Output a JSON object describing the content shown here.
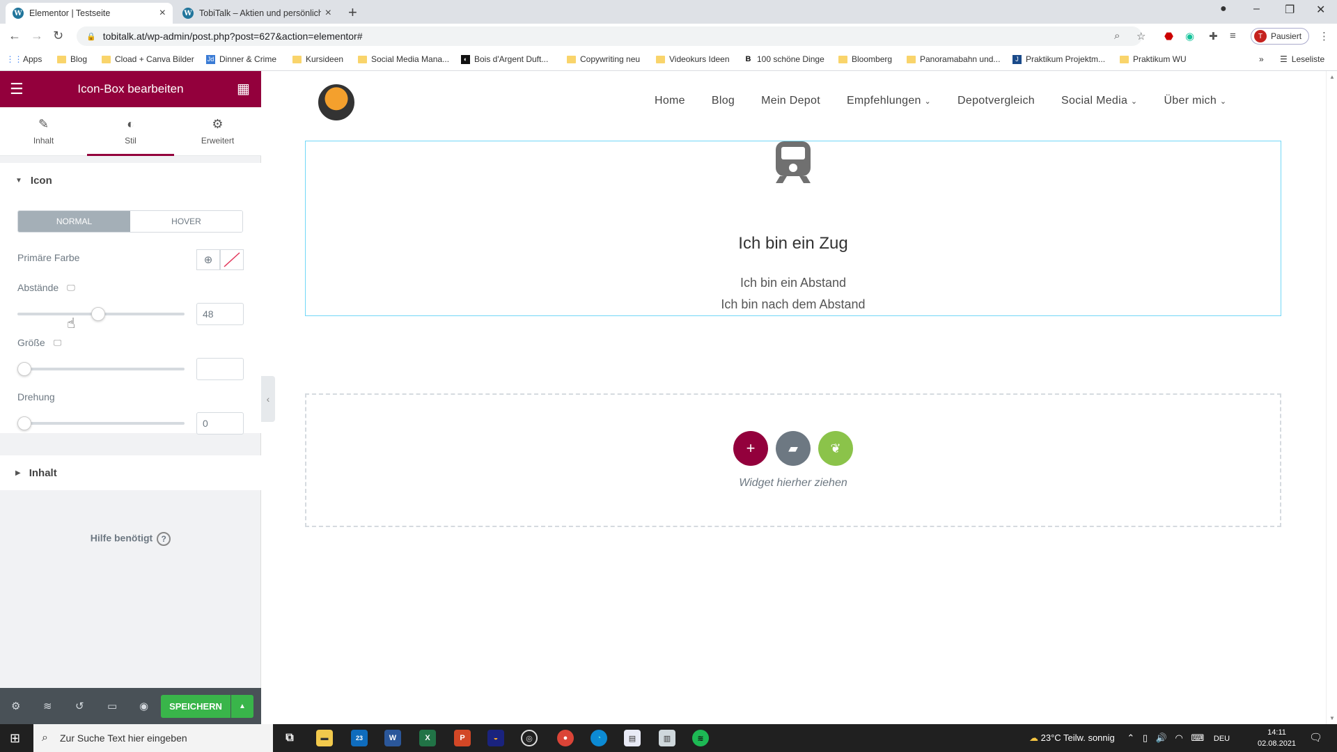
{
  "browser": {
    "tabs": [
      {
        "title": "Elementor | Testseite",
        "active": true
      },
      {
        "title": "TobiTalk – Aktien und persönliche",
        "active": false
      }
    ],
    "url": "tobitalk.at/wp-admin/post.php?post=627&action=elementor#",
    "profile_initial": "T",
    "profile_label": "Pausiert",
    "bookmarks": [
      "Apps",
      "Blog",
      "Cload + Canva Bilder",
      "Dinner & Crime",
      "Kursideen",
      "Social Media Mana...",
      "Bois d'Argent Duft...",
      "Copywriting neu",
      "Videokurs Ideen",
      "100 schöne Dinge",
      "Bloomberg",
      "Panoramabahn und...",
      "Praktikum Projektm...",
      "Praktikum WU"
    ],
    "reading_list": "Leseliste"
  },
  "panel": {
    "header_title": "Icon-Box bearbeiten",
    "tabs": [
      {
        "label": "Inhalt",
        "icon": "pencil-icon"
      },
      {
        "label": "Stil",
        "icon": "contrast-icon"
      },
      {
        "label": "Erweitert",
        "icon": "gear-icon"
      }
    ],
    "icon_section": {
      "title": "Icon",
      "state_normal": "NORMAL",
      "state_hover": "HOVER",
      "primary_color_label": "Primäre Farbe",
      "spacing_label": "Abstände",
      "spacing_value": "48",
      "spacing_fraction": 0.48,
      "size_label": "Größe",
      "size_value": "",
      "size_fraction": 0,
      "rotation_label": "Drehung",
      "rotation_value": "0",
      "rotation_fraction": 0
    },
    "content_section_title": "Inhalt",
    "help_label": "Hilfe benötigt",
    "save_label": "SPEICHERN"
  },
  "site": {
    "nav": [
      "Home",
      "Blog",
      "Mein Depot",
      "Empfehlungen",
      "Depotvergleich",
      "Social Media",
      "Über mich"
    ],
    "nav_dropdown": [
      false,
      false,
      false,
      true,
      false,
      true,
      true
    ],
    "box_title": "Ich bin ein Zug",
    "box_desc_line1": "Ich bin ein Abstand",
    "box_desc_line2": "Ich bin nach dem Abstand",
    "dropzone_label": "Widget hierher ziehen"
  },
  "taskbar": {
    "search_placeholder": "Zur Suche Text hier eingeben",
    "weather": "23°C  Teilw. sonnig",
    "language": "DEU",
    "time": "14:11",
    "date": "02.08.2021",
    "mail_badge": "23"
  },
  "colors": {
    "elementor_brand": "#93003c",
    "save_green": "#39b54a",
    "selection_border": "#71d7f7",
    "dz_add": "#93003c",
    "dz_template": "#6d7882",
    "dz_green": "#8bc34a"
  }
}
